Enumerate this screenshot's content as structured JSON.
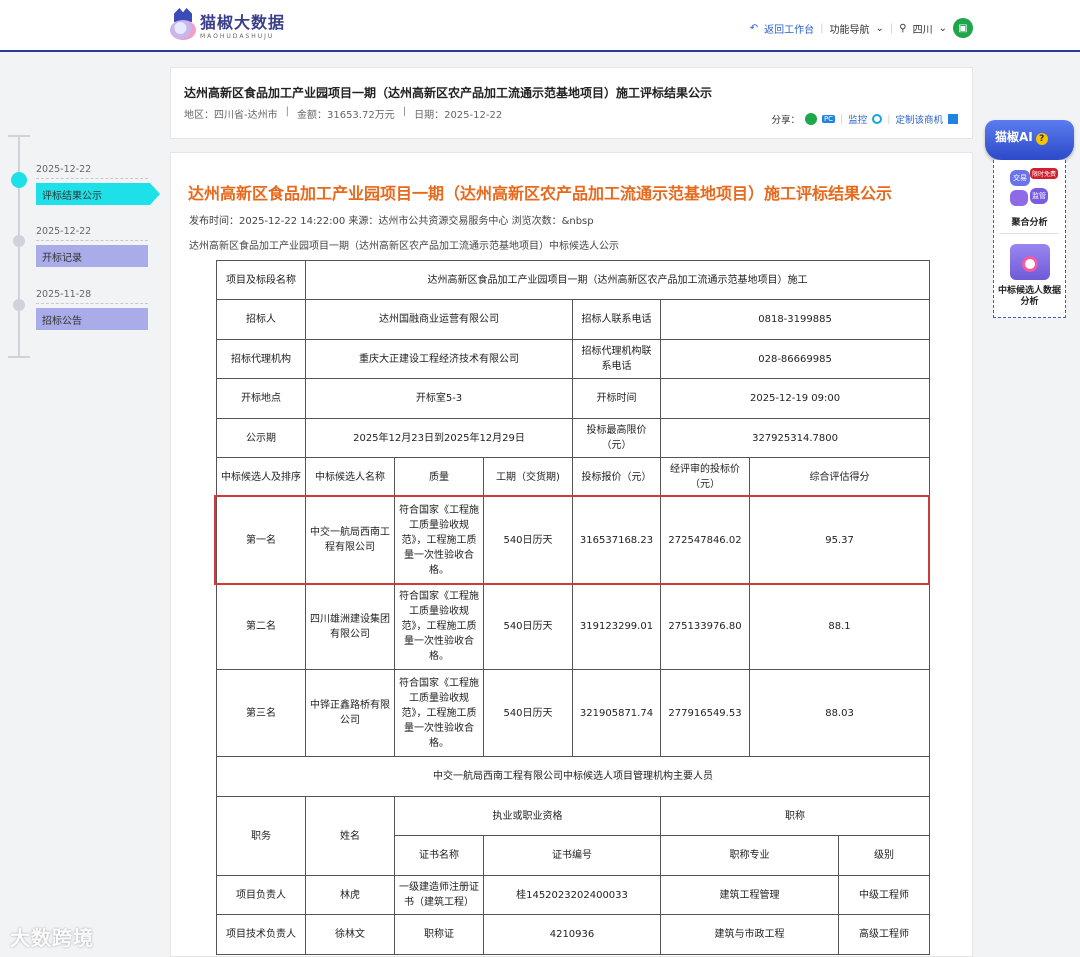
{
  "header": {
    "logo_cn": "猫椒大数据",
    "logo_en": "MAOHUDASHUJU",
    "back_label": "返回工作台",
    "nav_label": "功能导航",
    "region_label": "四川",
    "back_icon": "back-arrow-icon",
    "brand_color": "#2a3a9a"
  },
  "title_card": {
    "title": "达州高新区食品加工产业园项目一期（达州高新区农产品加工流通示范基地项目）施工评标结果公示",
    "region": "地区：四川省-达州市",
    "amount": "金额：31653.72万元",
    "date": "日期：2025-12-22",
    "share_label": "分享：",
    "pc_label": "PC",
    "monitor_label": "监控",
    "custom_label": "定制该商机"
  },
  "timeline": [
    {
      "date": "2025-12-22",
      "label": "评标结果公示",
      "active": true
    },
    {
      "date": "2025-12-22",
      "label": "开标记录",
      "active": false
    },
    {
      "date": "2025-11-28",
      "label": "招标公告",
      "active": false
    }
  ],
  "main": {
    "title": "达州高新区食品加工产业园项目一期（达州高新区农产品加工流通示范基地项目）施工评标结果公示",
    "pub_line": "发布时间：2025-12-22 14:22:00   来源：达州市公共资源交易服务中心   浏览次数：&nbsp",
    "subtitle": "达州高新区食品加工产业园项目一期（达州高新区农产品加工流通示范基地项目）中标候选人公示",
    "title_color": "#e8691c"
  },
  "table": {
    "project_label": "项目及标段名称",
    "project_name": "达州高新区食品加工产业园项目一期（达州高新区农产品加工流通示范基地项目）施工",
    "tenderer_label": "招标人",
    "tenderer": "达州国融商业运营有限公司",
    "tenderer_phone_label": "招标人联系电话",
    "tenderer_phone": "0818-3199885",
    "agent_label": "招标代理机构",
    "agent": "重庆大正建设工程经济技术有限公司",
    "agent_phone_label": "招标代理机构联系电话",
    "agent_phone": "028-86669985",
    "place_label": "开标地点",
    "place": "开标室5-3",
    "open_time_label": "开标时间",
    "open_time": "2025-12-19 09:00",
    "period_label": "公示期",
    "period": "2025年12月23日到2025年12月29日",
    "max_price_label": "投标最高限价（元）",
    "max_price": "327925314.7800",
    "head_rank": "中标候选人及排序",
    "head_name": "中标候选人名称",
    "head_quality": "质量",
    "head_duration": "工期（交货期)",
    "head_bid": "投标报价（元）",
    "head_reviewed": "经评审的投标价（元）",
    "head_score": "综合评估得分",
    "candidates": [
      {
        "rank": "第一名",
        "name": "中交一航局西南工程有限公司",
        "quality": "符合国家《工程施工质量验收规范》，工程施工质量一次性验收合格。",
        "duration": "540日历天",
        "bid": "316537168.23",
        "reviewed": "272547846.02",
        "score": "95.37"
      },
      {
        "rank": "第二名",
        "name": "四川雄洲建设集团有限公司",
        "quality": "符合国家《工程施工质量验收规范》，工程施工质量一次性验收合格。",
        "duration": "540日历天",
        "bid": "319123299.01",
        "reviewed": "275133976.80",
        "score": "88.1"
      },
      {
        "rank": "第三名",
        "name": "中铧正鑫路桥有限公司",
        "quality": "符合国家《工程施工质量验收规范》，工程施工质量一次性验收合格。",
        "duration": "540日历天",
        "bid": "321905871.74",
        "reviewed": "277916549.53",
        "score": "88.03"
      }
    ],
    "staff_title": "中交一航局西南工程有限公司中标候选人项目管理机构主要人员",
    "staff_head_role": "职务",
    "staff_head_name": "姓名",
    "staff_head_qual": "执业或职业资格",
    "staff_head_title": "职称",
    "staff_head_cert_name": "证书名称",
    "staff_head_cert_no": "证书编号",
    "staff_head_major": "职称专业",
    "staff_head_level": "级别",
    "staff": [
      {
        "role": "项目负责人",
        "name": "林虎",
        "cert_name": "一级建造师注册证书（建筑工程）",
        "cert_no": "桂1452023202400033",
        "major": "建筑工程管理",
        "level": "中级工程师"
      },
      {
        "role": "项目技术负责人",
        "name": "徐林文",
        "cert_name": "职称证",
        "cert_no": "4210936",
        "major": "建筑与市政工程",
        "level": "高级工程师"
      }
    ]
  },
  "ai_panel": {
    "title": "猫椒AI",
    "help_mark": "?",
    "tag": "限时免费",
    "chip1": "交易",
    "chip2": "监管",
    "sec1_label": "聚合分析",
    "sec2_label": "中标候选人数据分析"
  },
  "watermark": "大数跨境"
}
